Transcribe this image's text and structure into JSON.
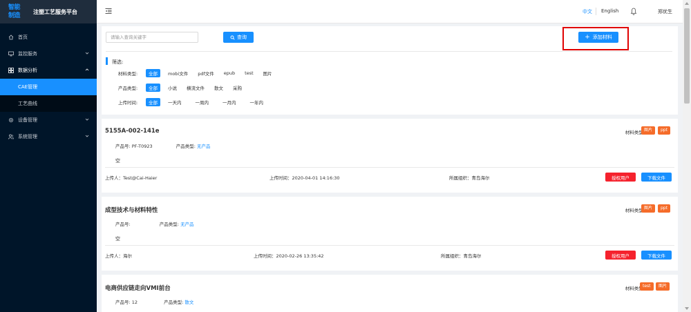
{
  "sidebar": {
    "logo_line1": "智能",
    "logo_line2": "制造",
    "app_title": "注塑工艺服务平台",
    "items": [
      {
        "label": "首页",
        "icon": "home-icon"
      },
      {
        "label": "监控服务",
        "icon": "monitor-icon"
      },
      {
        "label": "数据分析",
        "icon": "grid-icon"
      },
      {
        "label": "设备管理",
        "icon": "gear-icon"
      },
      {
        "label": "系统管理",
        "icon": "users-icon"
      }
    ],
    "sub_items": [
      {
        "label": "CAE管理",
        "active": true
      },
      {
        "label": "工艺曲线",
        "active": false
      }
    ]
  },
  "header": {
    "lang_zh": "中文",
    "lang_en": "English",
    "user_name": "郑优生"
  },
  "search": {
    "placeholder": "请输入查询关键字",
    "button_label": "查询",
    "add_button_label": "添加材料"
  },
  "filters": {
    "title": "筛选:",
    "rows": [
      {
        "label": "材料类型:",
        "options": [
          "全部",
          "mobi文件",
          "pdf文件",
          "epub",
          "test",
          "图片"
        ]
      },
      {
        "label": "产品类型:",
        "options": [
          "全部",
          "小说",
          "横流文件",
          "散文",
          "采购"
        ]
      },
      {
        "label": "上传时间:",
        "options": [
          "全部",
          "一天内",
          "一周内",
          "一月内",
          "一年内"
        ]
      }
    ]
  },
  "records": [
    {
      "title": "5155A-002-141e",
      "material_type_label": "材料类型:",
      "tags": [
        "图片",
        "ppt"
      ],
      "product_no": "产品号: PF-T0923",
      "product_type_label": "产品类型:",
      "product_type": "无产品",
      "empty_text": "空",
      "uploader": "上传人：Test@Cai-Haier",
      "upload_time": "上传时间：2020-04-01 14:16:30",
      "org": "所属组织：青岛海尔",
      "auth_label": "授权用户",
      "download_label": "下载文件"
    },
    {
      "title": "成型技术与材料特性",
      "material_type_label": "材料类型:",
      "tags": [
        "图片",
        "ppt"
      ],
      "product_no": "产品号:",
      "product_type_label": "产品类型:",
      "product_type": "无产品",
      "empty_text": "空",
      "uploader": "上传人：海尔",
      "upload_time": "上传时间：2020-02-26 13:35:42",
      "org": "所属组织：青岛海尔",
      "auth_label": "授权用户",
      "download_label": "下载文件"
    },
    {
      "title": "电商供应链走向VMI前台",
      "material_type_label": "材料类型:",
      "tags": [
        "test",
        "图片"
      ],
      "product_no": "产品号: 12",
      "product_type_label": "产品类型:",
      "product_type": "散文"
    }
  ],
  "colors": {
    "primary": "#1890ff",
    "danger": "#f5222d",
    "tag": "#f56c2a",
    "sidebar_bg": "#001529",
    "highlight_box": "#e00000"
  }
}
